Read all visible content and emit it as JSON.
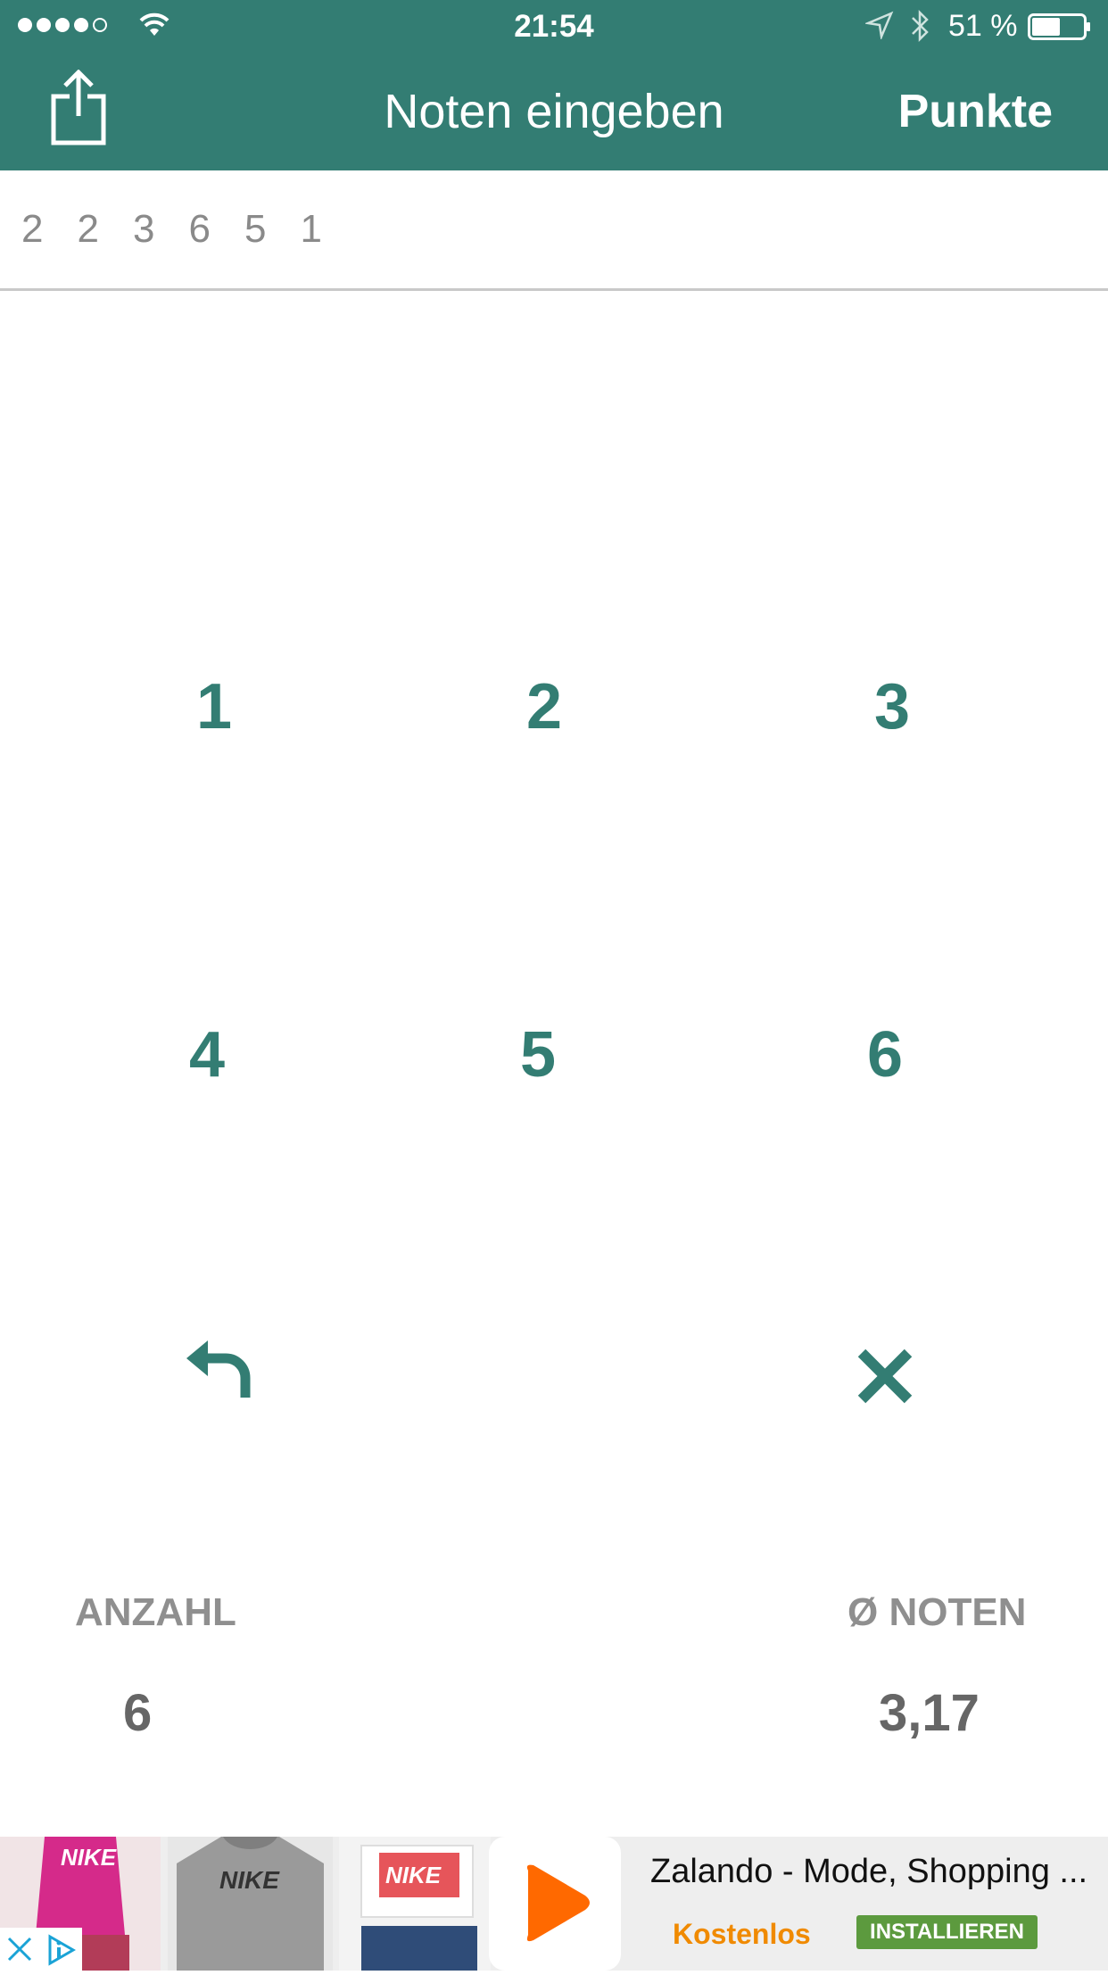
{
  "status_bar": {
    "time": "21:54",
    "battery_percent": "51 %",
    "signal_bars_filled": 4,
    "signal_bars_total": 5,
    "battery_level": 0.51
  },
  "nav": {
    "title": "Noten eingeben",
    "right_button": "Punkte",
    "left_icon": "share-icon"
  },
  "entered_grades": [
    "2",
    "2",
    "3",
    "6",
    "5",
    "1"
  ],
  "keypad": {
    "keys": [
      "1",
      "2",
      "3",
      "4",
      "5",
      "6"
    ],
    "undo_icon": "undo-arrow-icon",
    "clear_icon": "close-x-icon"
  },
  "stats": {
    "count_label": "ANZAHL",
    "count_value": "6",
    "average_label": "Ø NOTEN",
    "average_value": "3,17"
  },
  "ad": {
    "title": "Zalando - Mode, Shopping ...",
    "price": "Kostenlos",
    "install_button": "INSTALLIEREN",
    "thumbnail_brand": "NIKE",
    "close_icon": "close-icon",
    "adchoices_icon": "adchoices-icon"
  },
  "colors": {
    "primary": "#337d73",
    "ad_price": "#f08a00",
    "install_button": "#5c9a3e"
  }
}
